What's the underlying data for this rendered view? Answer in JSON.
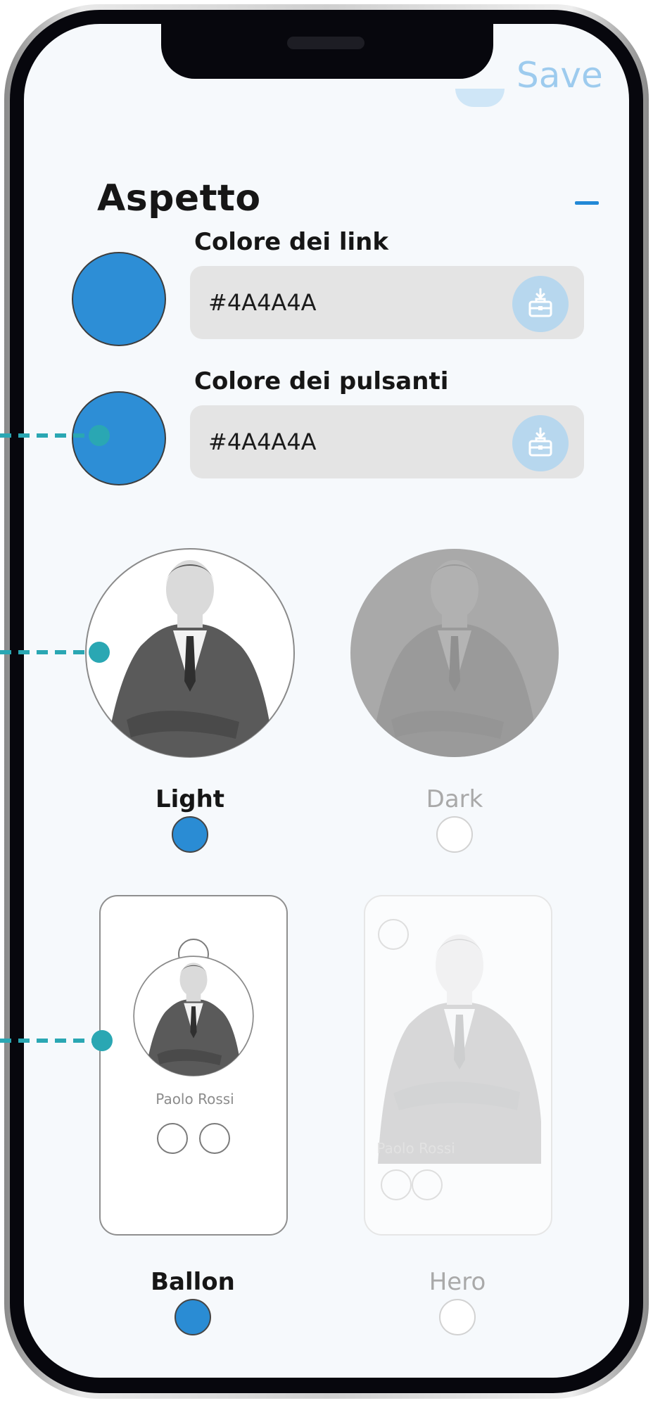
{
  "header": {
    "save_label": "Save"
  },
  "section": {
    "title": "Aspetto",
    "collapse_symbol": "–"
  },
  "colors": {
    "link": {
      "label": "Colore dei link",
      "value": "#4A4A4A",
      "swatch_color": "#2d8ed6"
    },
    "buttons": {
      "label": "Colore dei pulsanti",
      "value": "#4A4A4A",
      "swatch_color": "#2d8ed6"
    },
    "picker_icon": "color-picker-icon"
  },
  "theme": {
    "options": [
      {
        "label": "Light",
        "selected": true
      },
      {
        "label": "Dark",
        "selected": false
      }
    ]
  },
  "layout": {
    "options": [
      {
        "label": "Ballon",
        "selected": true,
        "preview_name": "Paolo Rossi"
      },
      {
        "label": "Hero",
        "selected": false,
        "preview_name": "Paolo Rossi"
      }
    ]
  },
  "palette": {
    "accent": "#2289d6",
    "connector": "#2aa7b3",
    "field_bg": "#e4e4e4",
    "screen_bg": "#f6f9fc"
  }
}
